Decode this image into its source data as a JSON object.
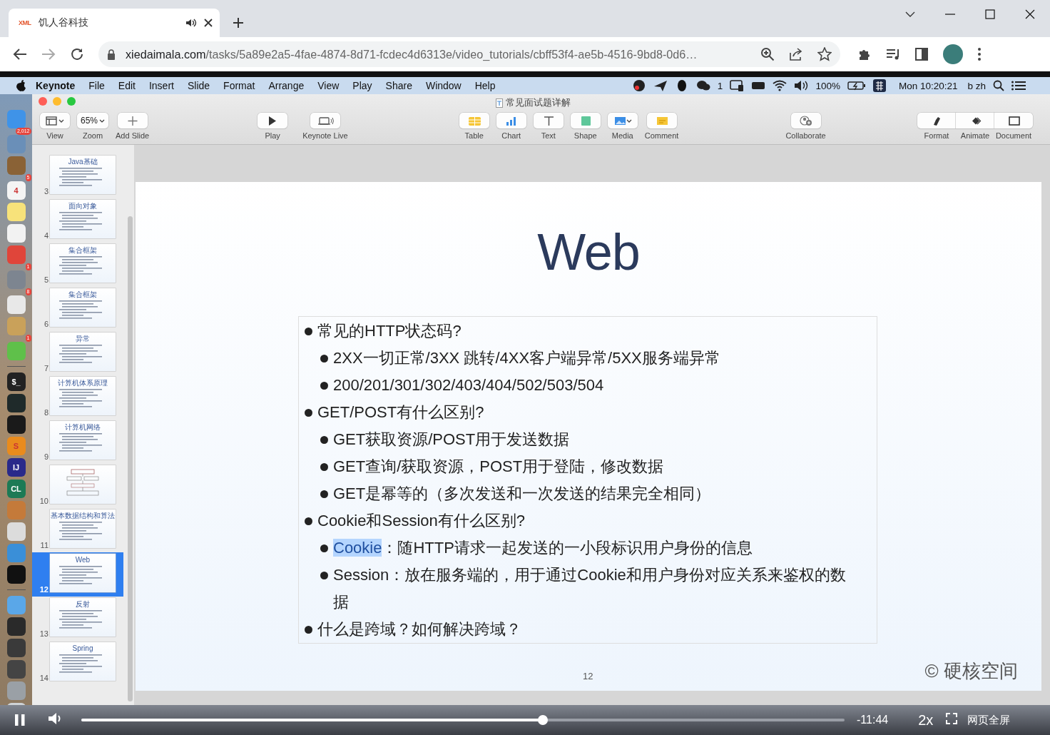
{
  "browser": {
    "tab": {
      "favicon_text": "XML",
      "title": "饥人谷科技",
      "audio_playing": true
    },
    "url": {
      "host": "xiedaimala.com",
      "path": "/tasks/5a89e2a5-4fae-4874-8d71-fcdec4d6313e/video_tutorials/cbff53f4-ae5b-4516-9bd8-0d6…"
    }
  },
  "menubar": {
    "app": "Keynote",
    "menus": [
      "File",
      "Edit",
      "Insert",
      "Slide",
      "Format",
      "Arrange",
      "View",
      "Play",
      "Share",
      "Window",
      "Help"
    ],
    "status": {
      "chat_count": "1",
      "battery": "100%",
      "clock": "Mon 10:20:21",
      "input": "b zh"
    }
  },
  "dock": {
    "apps": [
      {
        "kind": "app",
        "color": "#3f93e8"
      },
      {
        "kind": "app",
        "color": "#6a8fb8",
        "badge": "2,012"
      },
      {
        "kind": "app",
        "color": "#8a6236"
      },
      {
        "kind": "app",
        "color": "#f4f4f4",
        "label": "4",
        "badge": "5"
      },
      {
        "kind": "app",
        "color": "#f7e27a"
      },
      {
        "kind": "app",
        "color": "#f2f2f2"
      },
      {
        "kind": "app",
        "color": "#e0453a"
      },
      {
        "kind": "app",
        "color": "#7d8590",
        "badge": "1"
      },
      {
        "kind": "app",
        "color": "#e8e8e8",
        "badge": "8"
      },
      {
        "kind": "app",
        "color": "#c9a15a"
      },
      {
        "kind": "app",
        "color": "#5fc04a",
        "badge": "1"
      },
      {
        "kind": "separator"
      },
      {
        "kind": "app",
        "color": "#222222",
        "label": "$_"
      },
      {
        "kind": "app",
        "color": "#1f2a2a"
      },
      {
        "kind": "app",
        "color": "#1a1a1a"
      },
      {
        "kind": "app",
        "color": "#e98b1d",
        "label": "S"
      },
      {
        "kind": "app",
        "color": "#2a2a8a",
        "label": "IJ"
      },
      {
        "kind": "app",
        "color": "#1d7a55",
        "label": "CL"
      },
      {
        "kind": "app",
        "color": "#c47a3a"
      },
      {
        "kind": "app",
        "color": "#dcdcdc"
      },
      {
        "kind": "app",
        "color": "#3a8fd8"
      },
      {
        "kind": "app",
        "color": "#111111"
      },
      {
        "kind": "separator"
      },
      {
        "kind": "app",
        "color": "#5aa7e8"
      },
      {
        "kind": "app",
        "color": "#2a2a2a"
      },
      {
        "kind": "app",
        "color": "#3a3a3a"
      },
      {
        "kind": "app",
        "color": "#444444"
      },
      {
        "kind": "app",
        "color": "#9aa0a6"
      },
      {
        "kind": "app",
        "color": "#cfd3d6"
      }
    ]
  },
  "window": {
    "title": "常见面试题详解"
  },
  "toolbar": {
    "groups": [
      {
        "buttons": [
          {
            "kind": "view",
            "label": "View"
          },
          {
            "kind": "zoom",
            "value": "65%",
            "label": "Zoom"
          },
          {
            "kind": "plus",
            "label": "Add Slide"
          }
        ]
      },
      {
        "buttons": [
          {
            "kind": "play",
            "label": "Play"
          },
          {
            "kind": "live",
            "label": "Keynote Live"
          }
        ]
      },
      {
        "buttons": [
          {
            "kind": "table",
            "label": "Table"
          },
          {
            "kind": "chart",
            "label": "Chart"
          },
          {
            "kind": "text",
            "label": "Text"
          },
          {
            "kind": "shape",
            "label": "Shape"
          },
          {
            "kind": "media",
            "label": "Media"
          },
          {
            "kind": "comment",
            "label": "Comment"
          }
        ]
      },
      {
        "buttons": [
          {
            "kind": "collaborate",
            "label": "Collaborate"
          }
        ]
      },
      {
        "buttons": [
          {
            "kind": "format",
            "label": "Format"
          },
          {
            "kind": "animate",
            "label": "Animate"
          },
          {
            "kind": "document",
            "label": "Document"
          }
        ]
      }
    ]
  },
  "sidebar": {
    "thumbnails": [
      {
        "number": "3",
        "kind": "text",
        "title": "Java基础",
        "selected": false
      },
      {
        "number": "4",
        "kind": "text",
        "title": "面向对象",
        "selected": false
      },
      {
        "number": "5",
        "kind": "text",
        "title": "集合框架",
        "selected": false
      },
      {
        "number": "6",
        "kind": "text",
        "title": "集合框架",
        "selected": false
      },
      {
        "number": "7",
        "kind": "text",
        "title": "异常",
        "selected": false
      },
      {
        "number": "8",
        "kind": "text",
        "title": "计算机体系原理",
        "selected": false
      },
      {
        "number": "9",
        "kind": "text",
        "title": "计算机网络",
        "selected": false
      },
      {
        "number": "10",
        "kind": "diagram",
        "selected": false
      },
      {
        "number": "11",
        "kind": "text",
        "title": "基本数据结构和算法",
        "selected": false
      },
      {
        "number": "12",
        "kind": "text",
        "title": "Web",
        "selected": true
      },
      {
        "number": "13",
        "kind": "text",
        "title": "反射",
        "selected": false
      },
      {
        "number": "14",
        "kind": "text",
        "title": "Spring",
        "selected": false
      }
    ]
  },
  "slide": {
    "title": "Web",
    "items": [
      {
        "text": "常见的HTTP状态码?",
        "children": [
          {
            "text": "2XX一切正常/3XX 跳转/4XX客户端异常/5XX服务端异常"
          },
          {
            "text": "200/201/301/302/403/404/502/503/504"
          }
        ]
      },
      {
        "text": "GET/POST有什么区别?",
        "children": [
          {
            "text": "GET获取资源/POST用于发送数据"
          },
          {
            "text": "GET查询/获取资源，POST用于登陆，修改数据"
          },
          {
            "text": "GET是幂等的（多次发送和一次发送的结果完全相同）"
          }
        ]
      },
      {
        "text": "Cookie和Session有什么区别?",
        "children": [
          {
            "segments": [
              {
                "text": "Cookie",
                "highlighted": true
              },
              {
                "text": "：随HTTP请求一起发送的一小段标识用户身份的信息",
                "highlighted": false
              }
            ]
          },
          {
            "text": "Session：放在服务端的，用于通过Cookie和用户身份对应关系来鉴权的数据"
          }
        ]
      },
      {
        "text": "什么是跨域？如何解决跨域？"
      }
    ],
    "page_number": "12",
    "credit": "© 硬核空间"
  },
  "video": {
    "playing": true,
    "level": 0.605,
    "remaining": "-11:44",
    "speed": "2x",
    "web_fullscreen": "网页全屏"
  }
}
